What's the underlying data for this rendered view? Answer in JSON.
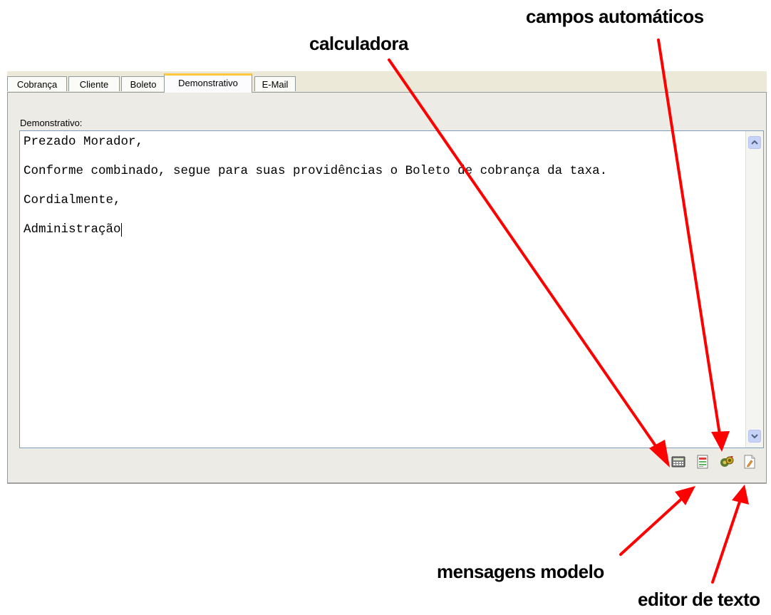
{
  "annotations": {
    "calculadora": "calculadora",
    "campos": "campos automáticos",
    "mensagens": "mensagens modelo",
    "editor": "editor de texto"
  },
  "tabs": [
    {
      "label": "Cobrança",
      "active": false
    },
    {
      "label": "Cliente",
      "active": false
    },
    {
      "label": "Boleto",
      "active": false
    },
    {
      "label": "Demonstrativo",
      "active": true
    },
    {
      "label": "E-Mail",
      "active": false
    }
  ],
  "field_label": "Demonstrativo:",
  "memo_lines": [
    "Prezado Morador,",
    "Conforme combinado, segue para suas providências o Boleto de cobrança da taxa.",
    "Cordialmente,",
    "Administração"
  ],
  "toolbar": {
    "calculator_icon": "calculator-icon",
    "template_messages_icon": "template-messages-icon",
    "auto_fields_icon": "auto-fields-icon",
    "text_editor_icon": "text-editor-icon"
  },
  "colors": {
    "arrow": "#ff0000",
    "active_tab_accent": "#ffc83c",
    "memo_border": "#7f9db9"
  }
}
